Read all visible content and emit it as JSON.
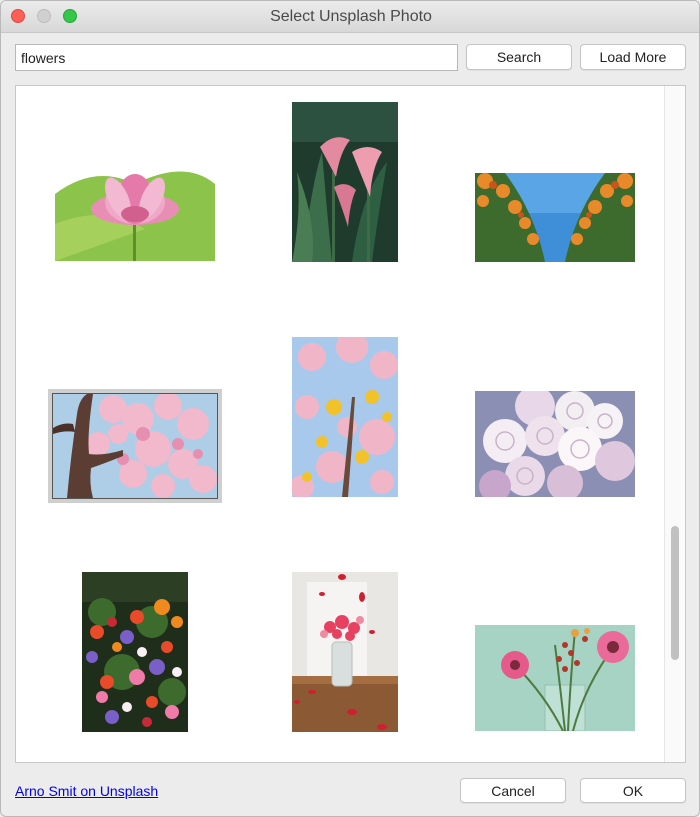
{
  "window": {
    "title": "Select Unsplash Photo"
  },
  "search": {
    "value": "flowers",
    "placeholder": ""
  },
  "buttons": {
    "search": "Search",
    "load_more": "Load More",
    "cancel": "Cancel",
    "ok": "OK"
  },
  "credit": {
    "text": "Arno Smit on Unsplash"
  },
  "photos": [
    {
      "subject": "pink lotus flower"
    },
    {
      "subject": "pink calla lilies"
    },
    {
      "subject": "orange marigold flowers and blue sky"
    },
    {
      "subject": "pink cherry blossom tree",
      "selected": true
    },
    {
      "subject": "cherry blossoms and yellow flowers"
    },
    {
      "subject": "white and lavender roses bouquet"
    },
    {
      "subject": "colorful anemone flower bed"
    },
    {
      "subject": "red roses in glass vase"
    },
    {
      "subject": "pink gerbera flowers in vase"
    }
  ]
}
